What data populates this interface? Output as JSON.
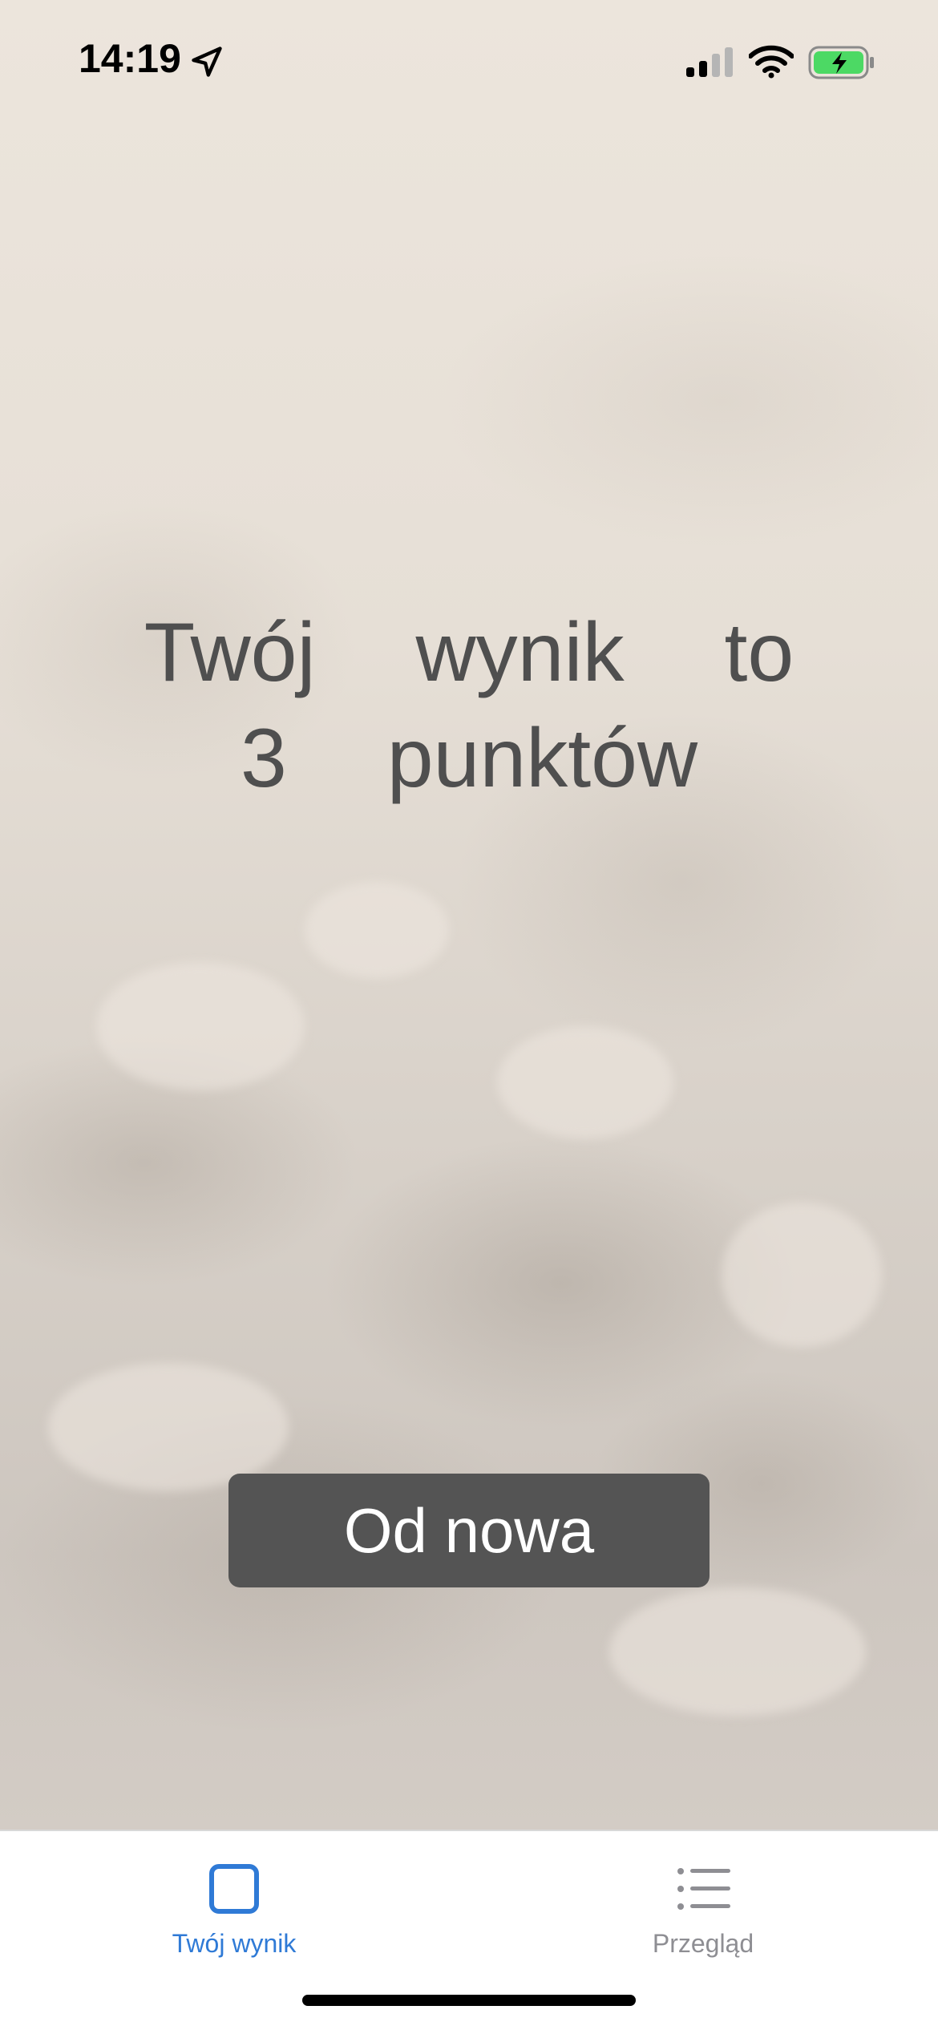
{
  "status_bar": {
    "time": "14:19",
    "icons": [
      "location-arrow-icon",
      "cellular-signal-icon",
      "wifi-icon",
      "battery-charging-icon"
    ],
    "battery_color": "#4cd964"
  },
  "main": {
    "score_line1": "Twój wynik to",
    "score_line2": "3 punktów",
    "restart_label": "Od nowa",
    "text_color": "#4f4f4f",
    "button_color": "#545454"
  },
  "tab_bar": {
    "tabs": [
      {
        "label": "Twój wynik",
        "icon": "square-icon",
        "active": true
      },
      {
        "label": "Przegląd",
        "icon": "list-icon",
        "active": false
      }
    ],
    "active_color": "#2f7ad6",
    "inactive_color": "#8e8e93"
  }
}
